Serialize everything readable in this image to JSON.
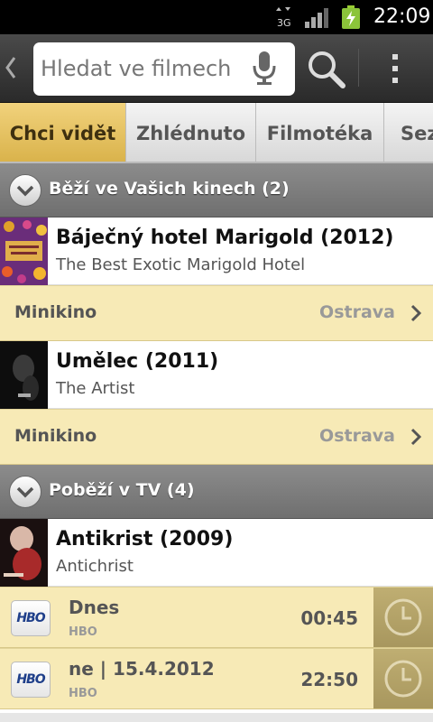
{
  "status_bar": {
    "network": "3G",
    "time": "22:09"
  },
  "action_bar": {
    "search_placeholder": "Hledat ve filmech"
  },
  "tabs": [
    {
      "label": "Chci vidět",
      "active": true
    },
    {
      "label": "Zhlédnuto",
      "active": false
    },
    {
      "label": "Filmotéka",
      "active": false
    },
    {
      "label": "Sez",
      "active": false
    }
  ],
  "sections": {
    "cinema": {
      "title": "Běží ve Vašich kinech (2)",
      "movies": [
        {
          "title": "Báječný hotel Marigold (2012)",
          "original": "The Best Exotic Marigold Hotel",
          "cinema": "Minikino",
          "city": "Ostrava"
        },
        {
          "title": "Umělec (2011)",
          "original": "The Artist",
          "cinema": "Minikino",
          "city": "Ostrava"
        }
      ]
    },
    "tv": {
      "title": "Poběží v TV (4)",
      "movie": {
        "title": "Antikrist (2009)",
        "original": "Antichrist"
      },
      "airings": [
        {
          "logo": "HBO",
          "day": "Dnes",
          "channel": "HBO",
          "time": "00:45"
        },
        {
          "logo": "HBO",
          "day": "ne | 15.4.2012",
          "channel": "HBO",
          "time": "22:50"
        }
      ]
    }
  },
  "colors": {
    "accent": "#d9b24a",
    "row_bg": "#f7eab6"
  }
}
